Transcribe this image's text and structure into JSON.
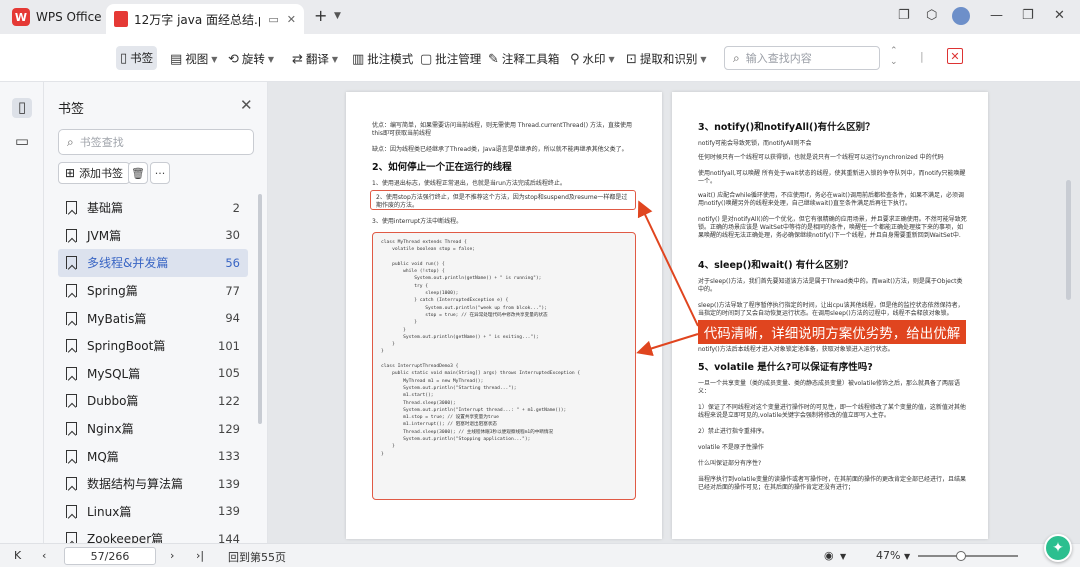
{
  "titlebar": {
    "app_name": "WPS Office",
    "tab_title": "12万字 java 面经总结.pdf"
  },
  "toolbar": {
    "items": [
      {
        "label": "书签",
        "icon": "bookmark-icon"
      },
      {
        "label": "视图",
        "icon": "view-icon"
      },
      {
        "label": "旋转",
        "icon": "rotate-icon"
      },
      {
        "label": "翻译",
        "icon": "translate-icon"
      },
      {
        "label": "批注模式",
        "icon": "annotate-icon"
      },
      {
        "label": "批注管理",
        "icon": "comment-icon"
      },
      {
        "label": "注释工具箱",
        "icon": "toolbox-icon"
      },
      {
        "label": "水印",
        "icon": "watermark-icon"
      },
      {
        "label": "提取和识别",
        "icon": "extract-icon"
      }
    ],
    "search_placeholder": "输入查找内容"
  },
  "panel": {
    "title": "书签",
    "search_placeholder": "书签查找",
    "add_label": "添加书签",
    "bookmarks": [
      {
        "label": "基础篇",
        "page": "2"
      },
      {
        "label": "JVM篇",
        "page": "30"
      },
      {
        "label": "多线程&并发篇",
        "page": "56",
        "selected": true
      },
      {
        "label": "Spring篇",
        "page": "77"
      },
      {
        "label": "MyBatis篇",
        "page": "94"
      },
      {
        "label": "SpringBoot篇",
        "page": "101"
      },
      {
        "label": "MySQL篇",
        "page": "105"
      },
      {
        "label": "Dubbo篇",
        "page": "122"
      },
      {
        "label": "Nginx篇",
        "page": "129"
      },
      {
        "label": "MQ篇",
        "page": "133"
      },
      {
        "label": "数据结构与算法篇",
        "page": "139"
      },
      {
        "label": "Linux篇",
        "page": "139"
      },
      {
        "label": "Zookeeper篇",
        "page": "144"
      }
    ]
  },
  "doc": {
    "left": {
      "p1": "优点：编写简单，如果需要访问当前线程，则无需使用 Thread.currentThread() 方法，直接使用 this即可获取当前线程",
      "p2": "缺点：因为线程类已经继承了Thread类，Java语言是单继承的，所以就不能再继承其他父类了。",
      "heading": "2、如何停止一个正在运行的线程",
      "item1": "1、使用退出标志，使线程正常退出，也就是当run方法完成后线程终止。",
      "item2": "2、使用stop方法强行终止，但是不推荐这个方法，因为stop和suspend及resume一样都是过期作废的方法。",
      "item3": "3、使用interrupt方法中断线程。",
      "code": "class MyThread extends Thread {\n    volatile boolean stop = false;\n\n    public void run() {\n        while (!stop) {\n            System.out.println(getName() + \" is running\");\n            try {\n                sleep(1000);\n            } catch (InterruptedException e) {\n                System.out.println(\"week up from blcok...\");\n                stop = true; // 在异常处理代码中修改共享变量的状态\n            }\n        }\n        System.out.println(getName() + \" is exiting...\");\n    }\n}\n\nclass InterruptThreadDemo3 {\n    public static void main(String[] args) throws InterruptedException {\n        MyThread m1 = new MyThread();\n        System.out.println(\"Starting thread...\");\n        m1.start();\n        Thread.sleep(3000);\n        System.out.println(\"Interrupt thread...: \" + m1.getName());\n        m1.stop = true; // 设置共享变量为true\n        m1.interrupt(); // 阻塞时退出阻塞状态\n        Thread.sleep(3000); // 主线程休眠3秒以便观察线程m1的中断情况\n        System.out.println(\"Stopping application...\");\n    }\n}"
    },
    "right": {
      "h1": "3、notify()和notifyAll()有什么区别？",
      "r1": "notify可能会导致死锁，而notifyAll则不会",
      "r2": "任何时候只有一个线程可以获得锁，也就是说只有一个线程可以运行synchronized 中的代码",
      "r3": "使用notifyall,可以唤醒 所有处于wait状态的线程，使其重新进入锁的争夺队列中，而notify只能唤醒一个。",
      "r4": "wait() 应配合while循环使用，不应使用if，务必在wait()调用前后都检查条件，如果不满足，必须调用notify()唤醒另外的线程来处理，自己继续wait()直至条件满足后再往下执行。",
      "r5": "notify() 是对notifyAll()的一个优化，但它有很精确的应用场景，并且要求正确使用。不然可能导致死锁。正确的场景应该是 WaitSet中等待的是相同的条件，唤醒任一个都能正确处理接下来的事项，如果唤醒的线程无法正确处理，务必确保继续notify()下一个线程，并且自身需要重新回到WaitSet中.",
      "h2": "4、sleep()和wait() 有什么区别？",
      "r6": "对于sleep()方法，我们首先要知道该方法是属于Thread类中的。而wait()方法，则是属于Object类中的。",
      "r7": "sleep()方法导致了程序暂停执行指定的时间，让出cpu该其他线程，但是他的监控状态依然保持者，当指定的时间到了又会自动恢复运行状态。在调用sleep()方法的过程中，线程不会释放对象锁。",
      "r8": "notify()方法后本线程才进入对象锁定池准备，获取对象锁进入运行状态。",
      "h3": "5、volatile 是什么?可以保证有序性吗?",
      "r9": "一旦一个共享变量（类的成员变量、类的静态成员变量）被volatile修饰之后，那么就具备了两层语义：",
      "r10": "1）保证了不同线程对这个变量进行操作时的可见性，即一个线程修改了某个变量的值，这新值对其他线程来说是立即可见的,volatile关键字会强制将修改的值立即写入主存。",
      "r11": "2）禁止进行指令重排序。",
      "r12": "volatile 不是原子性操作",
      "r13": "什么叫保证部分有序性?",
      "r14": "当程序执行到volatile变量的读操作或者写操作时，在其前面的操作的更改肯定全部已经进行，且结果已经对后面的操作可见；在其后面的操作肯定还没有进行；"
    },
    "callout": "代码清晰，详细说明方案优劣势，给出优解"
  },
  "statusbar": {
    "page_display": "57/266",
    "back_label": "回到第55页",
    "zoom": "47%"
  }
}
